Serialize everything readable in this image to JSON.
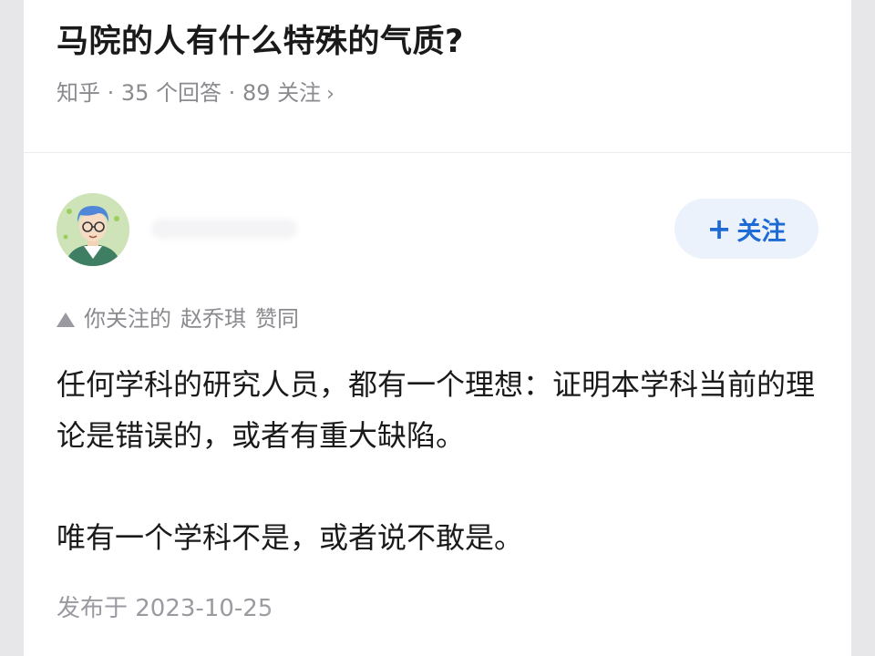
{
  "question": {
    "title": "马院的人有什么特殊的气质?",
    "meta": "知乎 · 35 个回答 · 89 关注",
    "chevron": "›"
  },
  "answer": {
    "follow": {
      "plus": "+",
      "label": "关注"
    },
    "upvote_note": {
      "prefix": "你关注的",
      "user": "赵乔琪",
      "action": "赞同"
    },
    "paragraphs": [
      "任何学科的研究人员，都有一个理想：证明本学科当前的理论是错误的，或者有重大缺陷。",
      "唯有一个学科不是，或者说不敢是。"
    ],
    "published": "发布于 2023-10-25"
  },
  "colors": {
    "accent": "#1e6bd6",
    "follow_bg": "#ebf2fb",
    "meta_gray": "#8a8a8f"
  },
  "icons": {
    "avatar": "cartoon-avatar",
    "upvote": "upvote-triangle-icon"
  }
}
